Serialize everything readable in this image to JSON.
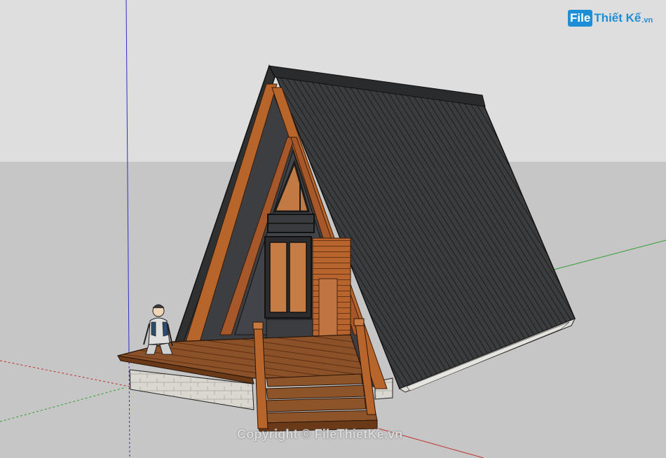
{
  "watermark": {
    "logo_file": "File",
    "logo_brand": "Thiết Kế",
    "logo_tld": ".vn",
    "copyright": "Copyright © FileThietKe.vn"
  },
  "colors": {
    "sky": "#dedede",
    "ground": "#c6c6c6",
    "roof": "#3a3b3d",
    "timber": "#b8652c",
    "deck": "#8a4f25",
    "stone": "#d8d6d0",
    "axis_blue": "#3030c8",
    "axis_green": "#2fa02f",
    "axis_red": "#c03030"
  },
  "icons": {
    "person": "human-figure-icon",
    "logo": "filethietke-logo-icon"
  }
}
